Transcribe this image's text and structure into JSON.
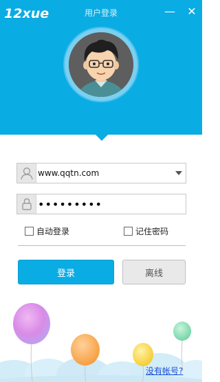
{
  "app": {
    "logo_text": "12xue",
    "window_title": "用户登录",
    "minimize_symbol": "—",
    "close_symbol": "✕"
  },
  "form": {
    "username_value": "www.qqtn.com",
    "password_value": "•••••••••",
    "auto_login_label": "自动登录",
    "auto_login_checked": false,
    "remember_password_label": "记住密码",
    "remember_password_checked": false
  },
  "buttons": {
    "login_label": "登录",
    "offline_label": "离线"
  },
  "footer": {
    "signup_link": "没有帐号?"
  },
  "colors": {
    "brand_blue": "#0aace4",
    "link_blue": "#1a4fd0"
  },
  "icons": {
    "username": "user-icon",
    "password": "lock-icon",
    "dropdown": "chevron-down-icon"
  }
}
